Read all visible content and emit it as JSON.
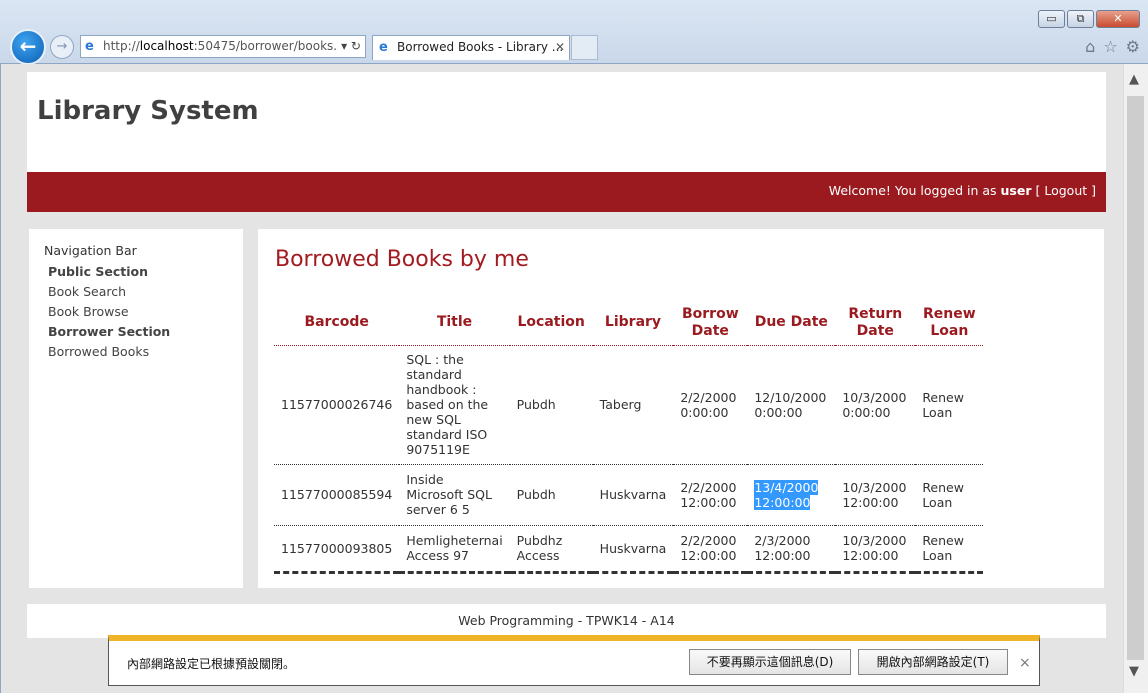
{
  "browser": {
    "window_controls": {
      "minimize": "▭",
      "restore": "⧉",
      "close": "✕"
    },
    "back_icon": "arrow-left-icon",
    "forward_icon": "arrow-right-icon",
    "address": {
      "prefix": "http://",
      "host": "localhost",
      "rest": ":50475/borrower/books.",
      "controls": "▾ ↻"
    },
    "tab": {
      "title": "Borrowed Books - Library ...",
      "close": "✕"
    },
    "tools": {
      "home": "⌂",
      "favorites": "☆",
      "settings": "⚙"
    }
  },
  "site": {
    "title": "Library System"
  },
  "userbar": {
    "welcome": "Welcome! You logged in as ",
    "user": "user",
    "logout": "[ Logout ]"
  },
  "nav": {
    "title": "Navigation Bar",
    "public_section": "Public Section",
    "book_search": "Book Search",
    "book_browse": "Book Browse",
    "borrower_section": "Borrower Section",
    "borrowed_books": "Borrowed Books"
  },
  "main": {
    "heading": "Borrowed Books by me",
    "columns": [
      "Barcode",
      "Title",
      "Location",
      "Library",
      "Borrow Date",
      "Due Date",
      "Return Date",
      "Renew Loan"
    ],
    "rows": [
      {
        "barcode": "11577000026746",
        "title": "SQL : the standard handbook : based on the new SQL standard ISO 9075119E",
        "location": "Pubdh",
        "library": "Taberg",
        "borrow": "2/2/2000 0:00:00",
        "due": "12/10/2000 0:00:00",
        "return": "10/3/2000 0:00:00",
        "renew": "Renew Loan"
      },
      {
        "barcode": "11577000085594",
        "title": "Inside Microsoft SQL server 6 5",
        "location": "Pubdh",
        "library": "Huskvarna",
        "borrow": "2/2/2000 12:00:00",
        "due": "13/4/2000 12:00:00",
        "return": "10/3/2000 12:00:00",
        "renew": "Renew Loan"
      },
      {
        "barcode": "11577000093805",
        "title": "Hemligheternai Access 97",
        "location": "Pubdhz Access",
        "library": "Huskvarna",
        "borrow": "2/2/2000 12:00:00",
        "due": "2/3/2000 12:00:00",
        "return": "10/3/2000 12:00:00",
        "renew": "Renew Loan"
      }
    ]
  },
  "footer": {
    "text": "Web Programming - TPWK14 - A14"
  },
  "notification": {
    "message": "內部網路設定已根據預設關閉。",
    "dont_show": "不要再顯示這個訊息(D)",
    "enable": "開啟內部網路設定(T)",
    "close": "×"
  },
  "scroll": {
    "up": "▲",
    "down": "▼"
  },
  "colors": {
    "accent": "#9a1a1f",
    "selection": "#3399ff",
    "notify_bar": "#f0b429"
  }
}
